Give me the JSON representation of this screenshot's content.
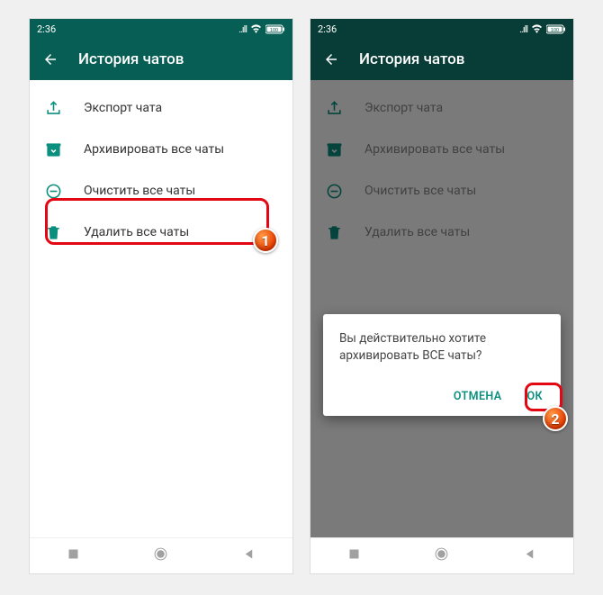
{
  "statusbar": {
    "time": "2:36",
    "battery": "100"
  },
  "appbar": {
    "title": "История чатов"
  },
  "menu": {
    "export": "Экспорт чата",
    "archive": "Архивировать все чаты",
    "clear": "Очистить все чаты",
    "delete": "Удалить все чаты"
  },
  "dialog": {
    "message": "Вы действительно хотите архивировать ВСЕ чаты?",
    "cancel": "ОТМЕНА",
    "ok": "ОК"
  },
  "badges": {
    "one": "1",
    "two": "2"
  },
  "colors": {
    "teal": "#075e54",
    "accent": "#0a8f7e",
    "highlight": "#e30613"
  }
}
